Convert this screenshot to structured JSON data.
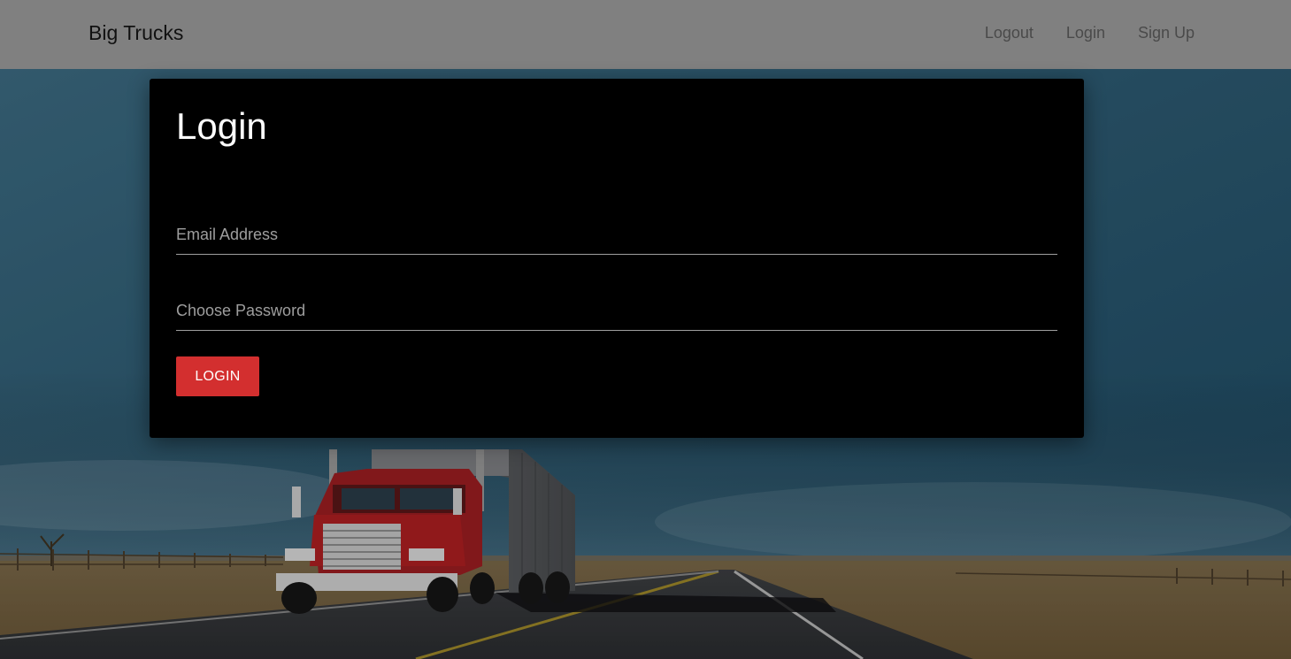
{
  "navbar": {
    "brand": "Big Trucks",
    "links": [
      {
        "label": "Logout"
      },
      {
        "label": "Login"
      },
      {
        "label": "Sign Up"
      }
    ]
  },
  "login_card": {
    "title": "Login",
    "email": {
      "placeholder": "Email Address",
      "value": ""
    },
    "password": {
      "placeholder": "Choose Password",
      "value": ""
    },
    "submit_label": "LOGIN"
  },
  "colors": {
    "navbar_bg": "#808080",
    "card_bg": "#000000",
    "button_bg": "#d32f2f",
    "truck_cab": "#b01f22"
  },
  "background": {
    "icon": "truck-on-highway-photo"
  }
}
